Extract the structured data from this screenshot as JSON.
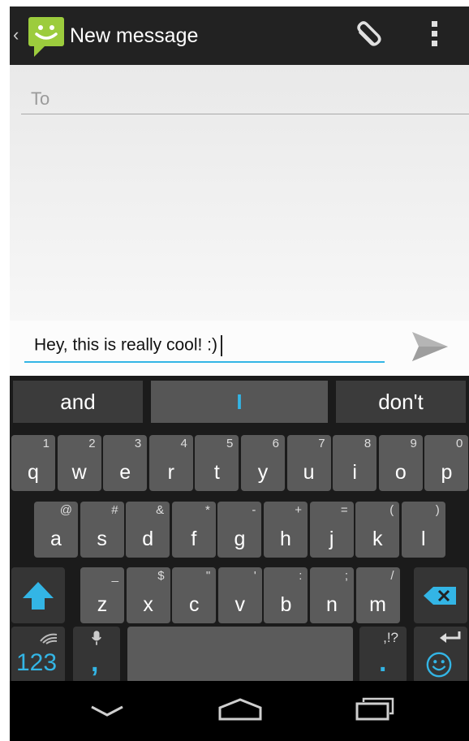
{
  "action_bar": {
    "title": "New message",
    "back_glyph": "‹",
    "app_icon": "messaging-smiley-icon",
    "attach_icon": "paperclip-icon",
    "overflow_icon": "overflow-menu-icon"
  },
  "compose": {
    "to_placeholder": "To",
    "message_text": "Hey,  this is really cool! :)",
    "send_icon": "send-icon"
  },
  "keyboard": {
    "suggestions": [
      "and",
      "I",
      "don't"
    ],
    "row1": [
      {
        "label": "q",
        "hint": "1"
      },
      {
        "label": "w",
        "hint": "2"
      },
      {
        "label": "e",
        "hint": "3"
      },
      {
        "label": "r",
        "hint": "4"
      },
      {
        "label": "t",
        "hint": "5"
      },
      {
        "label": "y",
        "hint": "6"
      },
      {
        "label": "u",
        "hint": "7"
      },
      {
        "label": "i",
        "hint": "8"
      },
      {
        "label": "o",
        "hint": "9"
      },
      {
        "label": "p",
        "hint": "0"
      }
    ],
    "row2": [
      {
        "label": "a",
        "hint": "@"
      },
      {
        "label": "s",
        "hint": "#"
      },
      {
        "label": "d",
        "hint": "&"
      },
      {
        "label": "f",
        "hint": "*"
      },
      {
        "label": "g",
        "hint": "-"
      },
      {
        "label": "h",
        "hint": "+"
      },
      {
        "label": "j",
        "hint": "="
      },
      {
        "label": "k",
        "hint": "("
      },
      {
        "label": "l",
        "hint": ")"
      }
    ],
    "row3": [
      {
        "label": "z",
        "hint": "_"
      },
      {
        "label": "x",
        "hint": "$"
      },
      {
        "label": "c",
        "hint": "\""
      },
      {
        "label": "v",
        "hint": "'"
      },
      {
        "label": "b",
        "hint": ":"
      },
      {
        "label": "n",
        "hint": ";"
      },
      {
        "label": "m",
        "hint": "/"
      }
    ],
    "shift_icon": "shift-arrow-icon",
    "backspace_icon": "backspace-icon",
    "symbols_label": "123",
    "comma_label": ",",
    "mic_icon": "microphone-icon",
    "punct_label": ",!?",
    "period_label": ".",
    "enter_icon": "enter-arrow-icon",
    "emoji_icon": "smiley-icon",
    "swiftkey_icon": "swiftkey-logo-icon"
  },
  "nav": {
    "back_icon": "back-chevron-icon",
    "home_icon": "home-icon",
    "recents_icon": "recent-apps-icon"
  },
  "colors": {
    "accent": "#33b5e5",
    "action_bar": "#222222",
    "key": "#5b5b5b",
    "app_green": "#8bc34a"
  }
}
